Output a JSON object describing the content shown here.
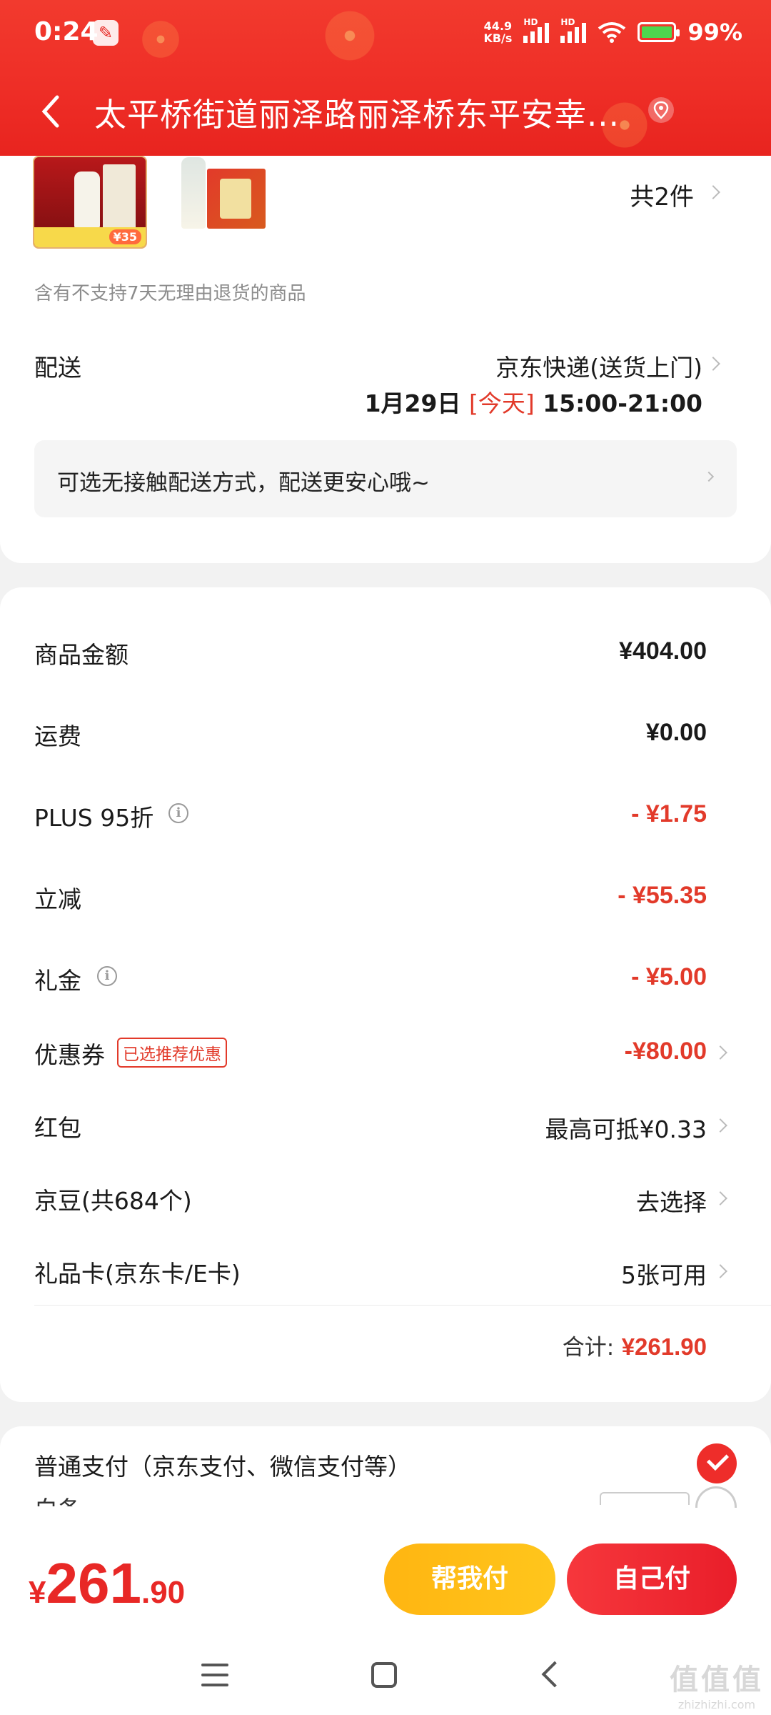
{
  "status_bar": {
    "time": "0:24",
    "net_speed_value": "44.9",
    "net_speed_unit": "KB/s",
    "hd_label": "HD",
    "battery": "99%"
  },
  "header": {
    "title": "太平桥街道丽泽路丽泽桥东平安幸..."
  },
  "products": {
    "count_label": "共2件",
    "notice": "含有不支持7天无理由退货的商品",
    "product1_price_tag": "¥35"
  },
  "delivery": {
    "label": "配送",
    "method": "京东快递(送货上门)",
    "date": "1月29日",
    "today": "[今天]",
    "time_range": "15:00-21:00",
    "tip": "可选无接触配送方式，配送更安心哦~"
  },
  "price_summary": {
    "rows": [
      {
        "label": "商品金额",
        "value": "¥404.00"
      },
      {
        "label": "运费",
        "value": "¥0.00"
      },
      {
        "label": "PLUS 95折",
        "value": "- ¥1.75"
      },
      {
        "label": "立减",
        "value": "- ¥55.35"
      },
      {
        "label": "礼金",
        "value": "- ¥5.00"
      },
      {
        "label": "优惠券",
        "value": "-¥80.00",
        "tag": "已选推荐优惠"
      },
      {
        "label": "红包",
        "value": "最高可抵¥0.33"
      },
      {
        "label": "京豆(共684个)",
        "value": "去选择"
      },
      {
        "label": "礼品卡(京东卡/E卡)",
        "value": "5张可用"
      }
    ],
    "total_label": "合计:",
    "total_value": "¥261.90"
  },
  "payment": {
    "option1": "普通支付（京东支付、微信支付等）",
    "option2_partial": "白条"
  },
  "bottom_bar": {
    "currency": "¥",
    "total_int": "261",
    "total_dec": ".90",
    "help_pay_label": "帮我付",
    "self_pay_label": "自己付"
  },
  "watermark": {
    "mark": "值值值",
    "url": "zhizhizhi.com"
  },
  "colors": {
    "brand_red": "#e23a2a",
    "header_red": "#ee2d26",
    "help_button": "#ffbd16",
    "self_button": "#ee2a33"
  }
}
